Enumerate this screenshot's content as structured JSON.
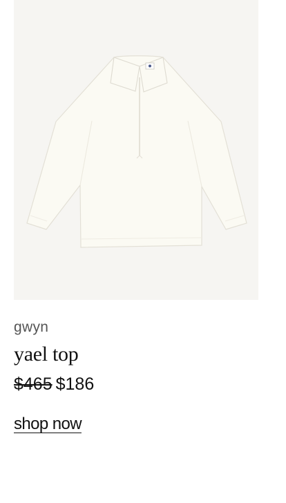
{
  "product": {
    "image_alt": "white long-sleeve collared pullover top",
    "brand": "gwyn",
    "name": "yael top",
    "price_original": "$465",
    "price_sale": "$186",
    "cta_label": "shop now"
  },
  "colors": {
    "image_background": "#f6f5f2",
    "garment": "#fbfaf3",
    "text": "#111111",
    "brand_text": "#555555"
  }
}
